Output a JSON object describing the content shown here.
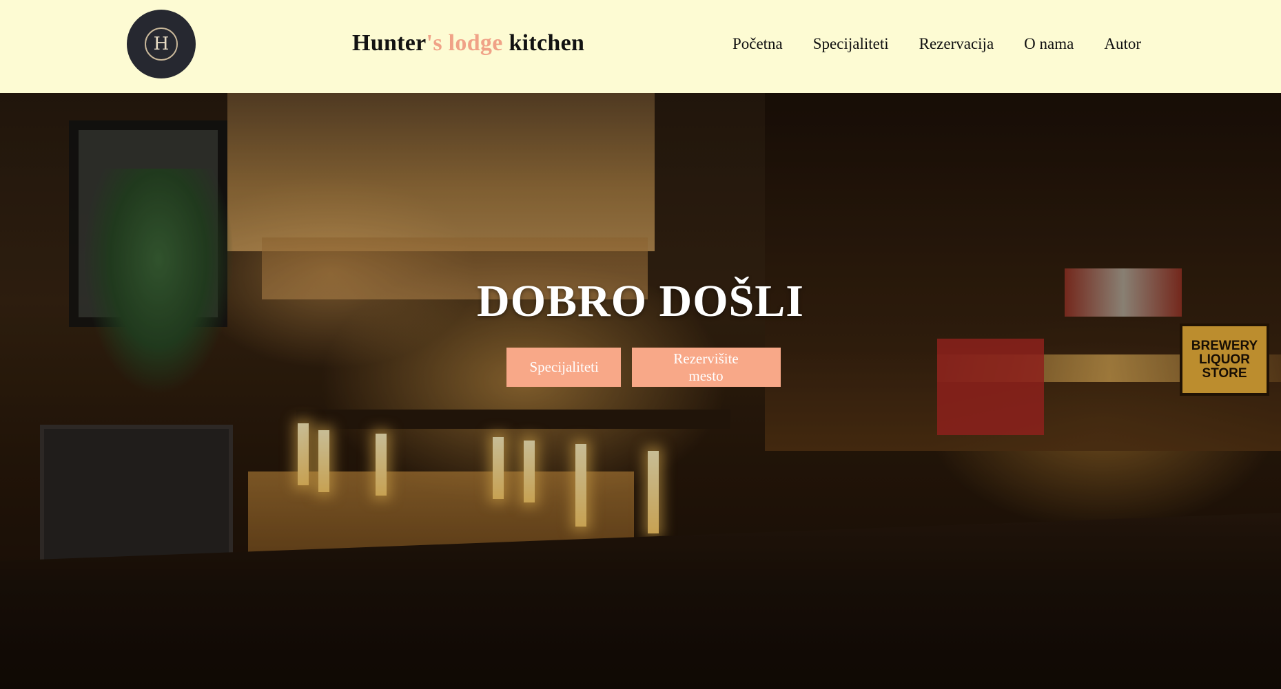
{
  "header": {
    "logo_letter": "H",
    "brand": {
      "part1": "Hunter",
      "apostrophe": "'s",
      "part2": "lodge",
      "part3": "kitchen"
    },
    "nav": [
      "Početna",
      "Specijaliteti",
      "Rezervacija",
      "O nama",
      "Autor"
    ]
  },
  "hero": {
    "title": "DOBRO DOŠLI",
    "buttons": {
      "specialties": "Specijaliteti",
      "reserve": "Rezervišite mesto"
    },
    "background_sign": "BREWERY LIQUOR STORE"
  },
  "colors": {
    "header_bg": "#fdfbd3",
    "accent": "#f0a287",
    "button_bg": "#f8a888",
    "logo_bg": "#262830"
  }
}
